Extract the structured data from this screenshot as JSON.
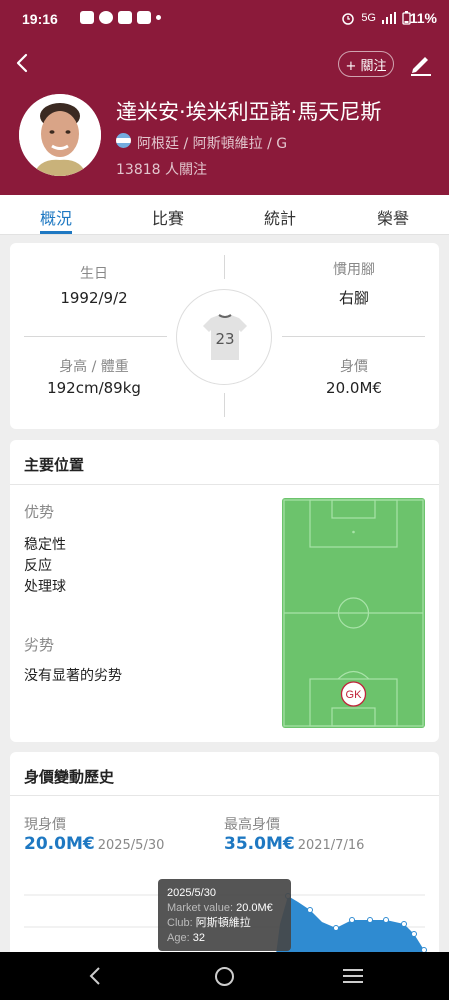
{
  "status": {
    "time": "19:16",
    "network": "5G",
    "battery": "11%"
  },
  "header": {
    "follow_label": "+ 關注",
    "player_name": "達米安·埃米利亞諾·馬天尼斯",
    "nation_line": "阿根廷 / 阿斯頓維拉 / G",
    "followers": "13818 人關注"
  },
  "tabs": [
    "概況",
    "比賽",
    "統計",
    "榮譽"
  ],
  "info": {
    "birth_label": "生日",
    "birth_value": "1992/9/2",
    "foot_label": "慣用腳",
    "foot_value": "右腳",
    "height_label": "身高 / 體重",
    "height_value": "192cm/89kg",
    "value_label": "身價",
    "value_value": "20.0M€",
    "jersey_number": "23"
  },
  "position": {
    "title": "主要位置",
    "strengths_label": "优势",
    "strengths": [
      "稳定性",
      "反应",
      "处理球"
    ],
    "weaknesses_label": "劣势",
    "weaknesses": [
      "没有显著的劣势"
    ],
    "marker": "GK"
  },
  "market": {
    "title": "身價變動歷史",
    "current_label": "現身價",
    "current_value": "20.0M€",
    "current_date": "2025/5/30",
    "highest_label": "最高身價",
    "highest_value": "35.0M€",
    "highest_date": "2021/7/16",
    "tooltip": {
      "date": "2025/5/30",
      "mv_key": "Market value:",
      "mv_val": "20.0M€",
      "club_key": "Club:",
      "club_val": "阿斯頓維拉",
      "age_key": "Age:",
      "age_val": "32"
    }
  },
  "colors": {
    "brand": "#8b1a3a",
    "accent": "#1e78c2",
    "pitch": "#6cc36c"
  }
}
